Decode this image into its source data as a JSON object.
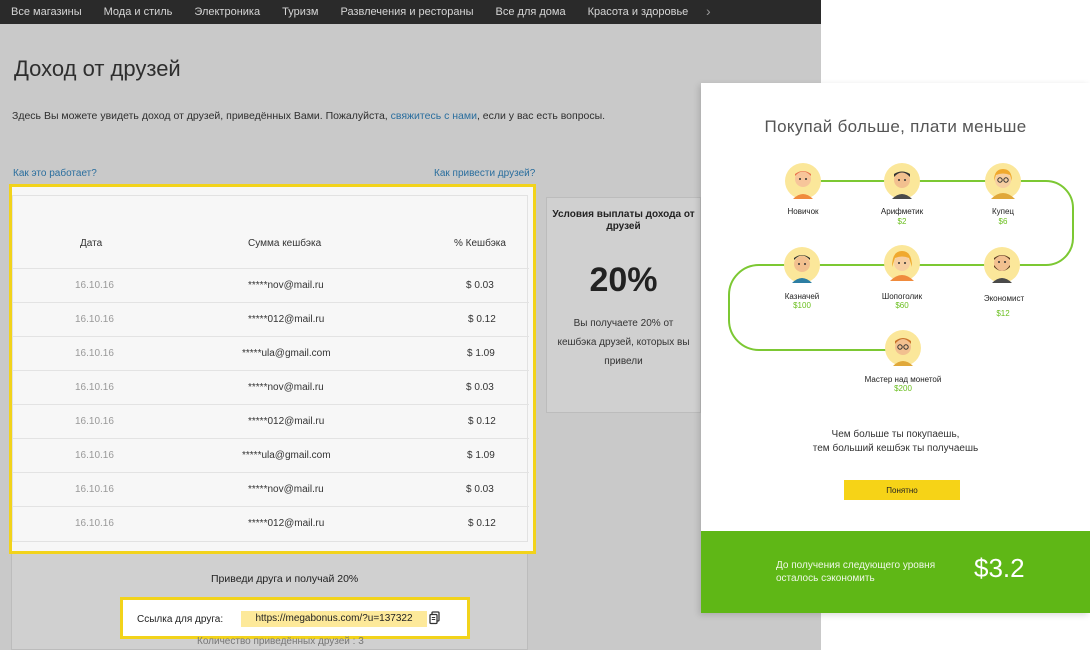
{
  "nav": {
    "items": [
      "Все магазины",
      "Мода и стиль",
      "Электроника",
      "Туризм",
      "Развлечения и рестораны",
      "Все для дома",
      "Красота и здоровье"
    ],
    "more_glyph": "›"
  },
  "page": {
    "title": "Доход от друзей",
    "intro_before": "Здесь Вы можете увидеть доход от друзей, приведённых Вами. Пожалуйста, ",
    "intro_link": "свяжитесь с нами",
    "intro_after": ", если у вас есть вопросы.",
    "how_it_works": "Как это работает?",
    "how_to_invite": "Как привести друзей?"
  },
  "table": {
    "headers": [
      "Дата",
      "Сумма кешбэка",
      "% Кешбэка"
    ],
    "rows": [
      [
        "16.10.16",
        "*****nov@mail.ru",
        "$ 0.03"
      ],
      [
        "16.10.16",
        "*****012@mail.ru",
        "$ 0.12"
      ],
      [
        "16.10.16",
        "*****ula@gmail.com",
        "$ 1.09"
      ],
      [
        "16.10.16",
        "*****nov@mail.ru",
        "$ 0.03"
      ],
      [
        "16.10.16",
        "*****012@mail.ru",
        "$ 0.12"
      ],
      [
        "16.10.16",
        "*****ula@gmail.com",
        "$ 1.09"
      ],
      [
        "16.10.16",
        "*****nov@mail.ru",
        "$ 0.03"
      ],
      [
        "16.10.16",
        "*****012@mail.ru",
        "$ 0.12"
      ]
    ]
  },
  "conditions": {
    "title": "Условия выплаты дохода от друзей",
    "percent": "20%",
    "description": "Вы получаете 20% от кешбэка друзей, которых вы привели"
  },
  "referral": {
    "promo": "Приведи друга и получай 20%",
    "label": "Ссылка для друга:",
    "url": "https://megabonus.com/?u=137322",
    "copy_icon": "copy-icon",
    "friends_count": "Количество приведённых друзей : 3"
  },
  "modal": {
    "title": "Покупай больше, плати меньше",
    "levels": [
      {
        "name": "Новичок",
        "price": ""
      },
      {
        "name": "Арифметик",
        "price": "$2"
      },
      {
        "name": "Купец",
        "price": "$6"
      },
      {
        "name": "Казначей",
        "price": "$100"
      },
      {
        "name": "Шопоголик",
        "price": "$60"
      },
      {
        "name": "Экономист",
        "price": "$12"
      },
      {
        "name": "Мастер над монетой",
        "price": "$200"
      }
    ],
    "desc_line1": "Чем больше ты покупаешь,",
    "desc_line2": "тем больший кешбэк ты получаешь",
    "button": "Понятно",
    "footer_line1": "До получения следующего уровня",
    "footer_line2": "осталось сэкономить",
    "footer_value": "$3.2"
  },
  "colors": {
    "accent_green": "#5fb716",
    "price_green": "#6abf1e",
    "highlight_yellow": "#f2d31b",
    "link_blue": "#2a6e9e",
    "nav_bg": "#2a2a2a"
  }
}
